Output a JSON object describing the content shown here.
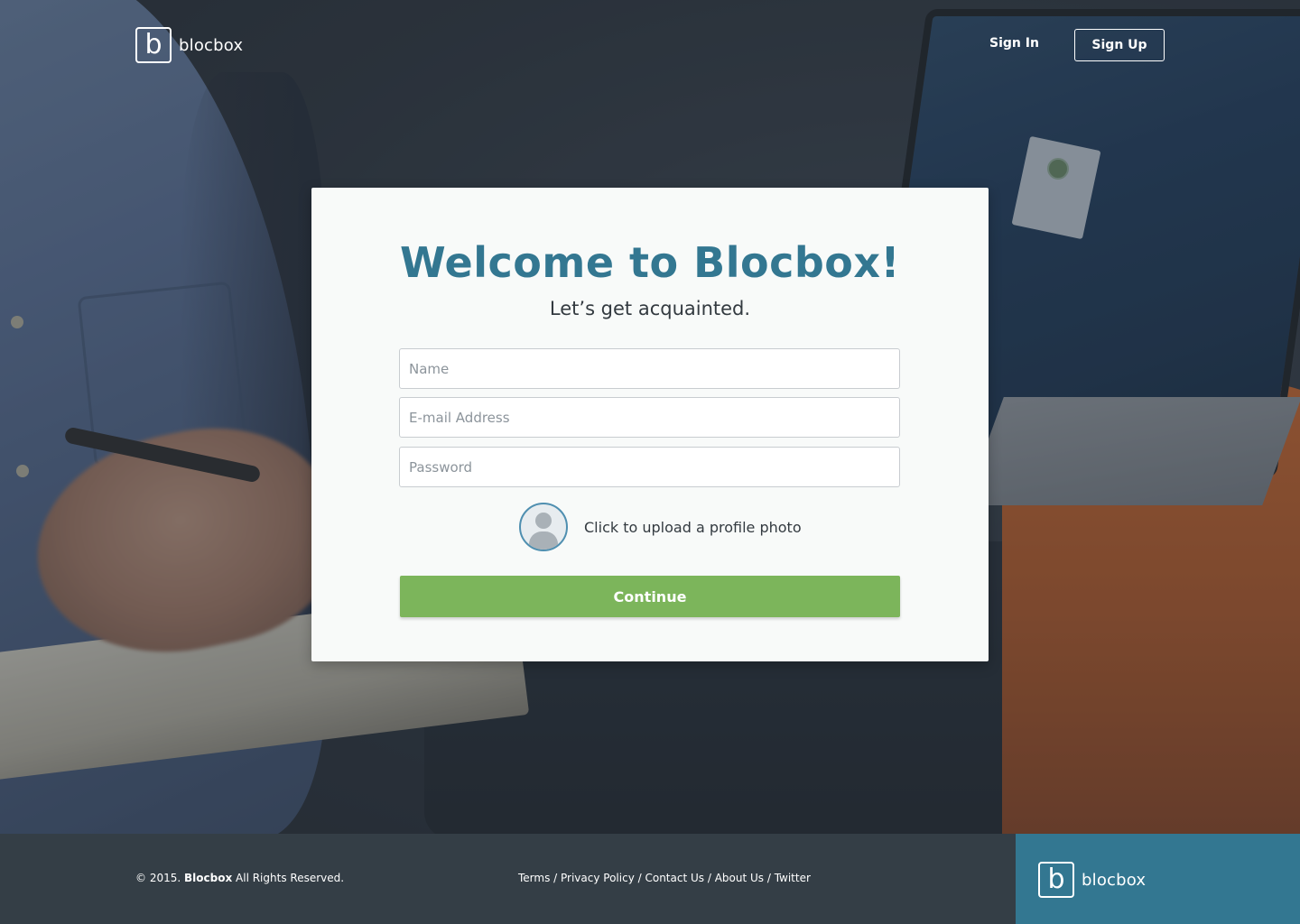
{
  "header": {
    "logo_letter": "b",
    "logo_text": "blocbox",
    "signin_label": "Sign In",
    "signup_label": "Sign Up"
  },
  "card": {
    "title": "Welcome to Blocbox!",
    "subtitle": "Let’s get acquainted.",
    "fields": {
      "name_placeholder": "Name",
      "email_placeholder": "E-mail Address",
      "password_placeholder": "Password"
    },
    "upload_label": "Click to upload a profile photo",
    "continue_label": "Continue"
  },
  "footer": {
    "copyright_prefix": "© 2015.",
    "copyright_brand": "Blocbox",
    "copyright_suffix": "All Rights Reserved.",
    "links": [
      "Terms",
      "Privacy Policy",
      "Contact Us",
      "About Us",
      "Twitter"
    ],
    "separator": " / ",
    "logo_letter": "b",
    "logo_text": "blocbox"
  },
  "colors": {
    "accent": "#337791",
    "continue": "#7cb55b",
    "footer_bg": "#343e46"
  }
}
